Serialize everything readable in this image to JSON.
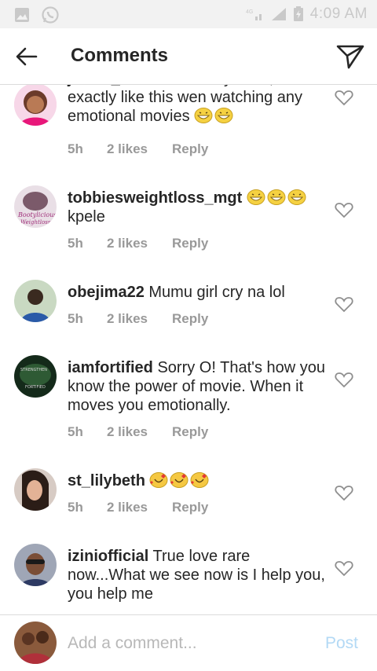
{
  "status_bar": {
    "time": "4:09 AM",
    "icons": [
      "image-icon",
      "whatsapp-icon",
      "wifi-icon",
      "signal-icon",
      "battery-icon"
    ]
  },
  "header": {
    "title": "Comments",
    "back_icon": "arrow-left-icon",
    "send_icon": "paper-plane-icon"
  },
  "comments": [
    {
      "username": "jessiv_bae",
      "text": " is not funny at all,am exactly like this wen watching any emotional movies",
      "emoji": [
        "grin",
        "grin"
      ],
      "time": "5h",
      "likes": "2 likes",
      "reply": "Reply"
    },
    {
      "username": "tobbiesweightloss_mgt",
      "text": " kpele",
      "emoji_after_user": [
        "grin",
        "grin",
        "grin"
      ],
      "time": "5h",
      "likes": "2 likes",
      "reply": "Reply"
    },
    {
      "username": "obejima22",
      "text": " Mumu girl cry na lol",
      "time": "5h",
      "likes": "2 likes",
      "reply": "Reply"
    },
    {
      "username": "iamfortified",
      "text": " Sorry O! That's how you know the power of movie. When it moves you emotionally.",
      "time": "5h",
      "likes": "2 likes",
      "reply": "Reply"
    },
    {
      "username": "st_lilybeth",
      "text": "",
      "emoji_after_user": [
        "hearts-face",
        "hearts-face",
        "hearts-face"
      ],
      "time": "5h",
      "likes": "2 likes",
      "reply": "Reply"
    },
    {
      "username": "iziniofficial",
      "text": " True love rare now...What we see now is I help you, you help me",
      "time": "",
      "likes": "",
      "reply": ""
    }
  ],
  "composer": {
    "placeholder": "Add a comment...",
    "post_label": "Post"
  },
  "colors": {
    "text": "#262626",
    "meta": "#999999",
    "post_disabled": "#b3d9f5",
    "divider": "#dbdbdb"
  }
}
